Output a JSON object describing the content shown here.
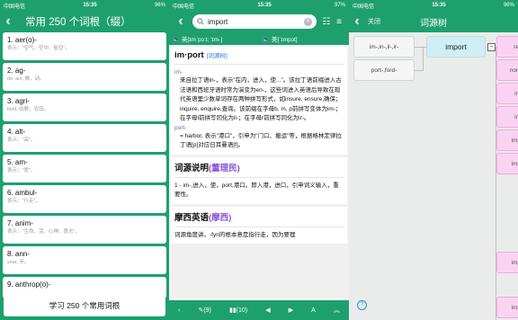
{
  "status": {
    "p1": {
      "carrier": "中国电信",
      "time": "15:35",
      "battery": "96%"
    },
    "p2": {
      "carrier": "中国电信",
      "time": "15:35",
      "battery": "97%"
    },
    "p3": {
      "carrier": "中国电信",
      "time": "15:35",
      "battery": "96%"
    }
  },
  "panel1": {
    "title": "常用 250 个词根（缀）",
    "roots": [
      {
        "name": "1. aer(o)-",
        "desc": "表示：\"空气、空中、航空\"。"
      },
      {
        "name": "2. ag-",
        "desc": "do, act, 做，动。"
      },
      {
        "name": "3. agri-",
        "desc": "field, 田野，农田。"
      },
      {
        "name": "4. alt-",
        "desc": "表示：\"高\"。"
      },
      {
        "name": "5. am-",
        "desc": "表示：\"爱\"。"
      },
      {
        "name": "6. ambul-",
        "desc": "表示：\"行走\"。"
      },
      {
        "name": "7. anim-",
        "desc": "表示：\"生命、活、心神、意志\"。"
      },
      {
        "name": "8. ann-",
        "desc": "year, 年。"
      },
      {
        "name": "9. anthrop(o)-",
        "desc": ""
      }
    ],
    "learn_button": "学习 250 个常用词根"
  },
  "panel2": {
    "search_query": "import",
    "phonetic_uk": "英[ɪmˈpɔːt; 'ɪm-]",
    "phonetic_us": "美[ˈɪmpɔt]",
    "word": "im·port",
    "word_tag": "[词源树]",
    "prefix1": "im-",
    "def1": "来自拉丁语in-，表示\"在内，进入，使...\"。该拉丁语前缀进入古法语和西班牙语时常为演变为en-，这些词进入英语后导致在现代英语里少数单词存在两种拼写形式，如insure, ensure,确保；inquire, enquire,查询。该前缀在字母b, m, p前拼写变体为im-；在字母l前拼写同化为il-；在字母r前拼写同化为ir-。",
    "prefix2": "port-",
    "def2": "= harbor, 表示\"港口\"，引申为\"门口、搬运\"等，根据格林定律拉丁语[p]对应日耳曼语[f]。",
    "etym_title": "词源说明",
    "etym_link": "(董理民)",
    "etym_text": "1 - im-,进入，使，port,港口。即入港，进口，引申词义输入，重要性。",
    "moxi_title": "摩西英语",
    "moxi_link": "(摩西)",
    "moxi_text": "词源角度讲，-fyri的根本意是指行走，因为要理",
    "bottom": {
      "pen_count": "(9)",
      "book_count": "(10)",
      "font_label": "A"
    }
  },
  "panel3": {
    "close_label": "关闭",
    "title": "词源树",
    "nodes": {
      "left_top": "im-,in-,il-,ir-",
      "left_bottom": "port-,ford-",
      "center": "import",
      "r1": "re",
      "r2": "noni",
      "r3": "im",
      "r4": "im",
      "r5": "imp",
      "r6": "imp",
      "r7": "imp",
      "r8": "imp"
    },
    "collapse_symbol": "−",
    "help_symbol": "?"
  }
}
